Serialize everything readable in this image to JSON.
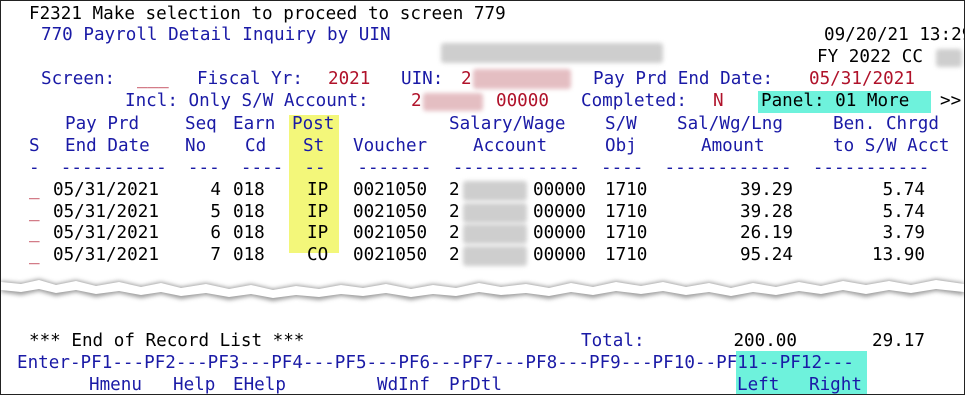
{
  "header": {
    "message": "F2321 Make selection to proceed to screen 779",
    "screen_title": "770 Payroll Detail Inquiry by UIN",
    "datetime": "09/20/21 13:29",
    "fy_cc": "FY 2022 CC"
  },
  "selection": {
    "screen_label": "Screen:",
    "screen_value": "___",
    "fiscal_yr_label": "Fiscal Yr:",
    "fiscal_yr_value": "2021",
    "uin_label": "UIN:",
    "uin_value_visible": "2",
    "pay_prd_end_label": "Pay Prd End Date:",
    "pay_prd_end_value": "05/31/2021",
    "incl_label": "Incl: Only S/W Account:",
    "incl_account_visible": "2",
    "incl_account_suffix": "00000",
    "completed_label": "Completed:",
    "completed_value": "N",
    "panel_label": "Panel: 01 More",
    "more_arrows": ">>"
  },
  "table": {
    "headers_line1": {
      "pay_prd": "Pay Prd",
      "seq": "Seq",
      "earn": "Earn",
      "post": "Post",
      "salary_wage": "Salary/Wage",
      "sw": "S/W",
      "sal_wg_lng": "Sal/Wg/Lng",
      "ben_chrgd": "Ben. Chrgd"
    },
    "headers_line2": {
      "s": "S",
      "end_date": "End Date",
      "no": "No",
      "cd": "Cd",
      "st": "St",
      "voucher": "Voucher",
      "account": "Account",
      "obj": "Obj",
      "amount": "Amount",
      "to_sw_acct": "to S/W Acct"
    },
    "dash_line": "-  ----------  ---  ----  --   -------  ------------  ----  ------------  -----------",
    "rows": [
      {
        "sel": "_",
        "end_date": "05/31/2021",
        "seq": "4",
        "earn": "018",
        "post": "IP",
        "voucher": "0021050",
        "acct_prefix": "2",
        "acct_suffix": "00000",
        "obj": "1710",
        "amount": "39.29",
        "ben": "5.74"
      },
      {
        "sel": "_",
        "end_date": "05/31/2021",
        "seq": "5",
        "earn": "018",
        "post": "IP",
        "voucher": "0021050",
        "acct_prefix": "2",
        "acct_suffix": "00000",
        "obj": "1710",
        "amount": "39.28",
        "ben": "5.74"
      },
      {
        "sel": "_",
        "end_date": "05/31/2021",
        "seq": "6",
        "earn": "018",
        "post": "IP",
        "voucher": "0021050",
        "acct_prefix": "2",
        "acct_suffix": "00000",
        "obj": "1710",
        "amount": "26.19",
        "ben": "3.79"
      },
      {
        "sel": "_",
        "end_date": "05/31/2021",
        "seq": "7",
        "earn": "018",
        "post": "CO",
        "voucher": "0021050",
        "acct_prefix": "2",
        "acct_suffix": "00000",
        "obj": "1710",
        "amount": "95.24",
        "ben": "13.90"
      }
    ]
  },
  "footer": {
    "end_of_list": "*** End of Record List ***",
    "total_label": "Total:",
    "total_amount": "200.00",
    "total_ben": "29.17",
    "pf_keys": [
      "Enter-PF1---PF2---PF3---PF4---PF5---PF6---PF7---PF8---PF9---",
      "PF10--PF11",
      "--PF12---"
    ],
    "pf_labels": {
      "hmenu": "Hmenu",
      "help": "Help",
      "ehelp": "EHelp",
      "wdinf": "WdInf",
      "prdtl": "PrDtl",
      "left": "Left",
      "right": "Right"
    }
  },
  "colors": {
    "field_blue": "#1a1aa6",
    "value_red": "#b0122a",
    "highlight_yellow": "#f3f77a",
    "highlight_cyan": "#6ef2dc"
  }
}
